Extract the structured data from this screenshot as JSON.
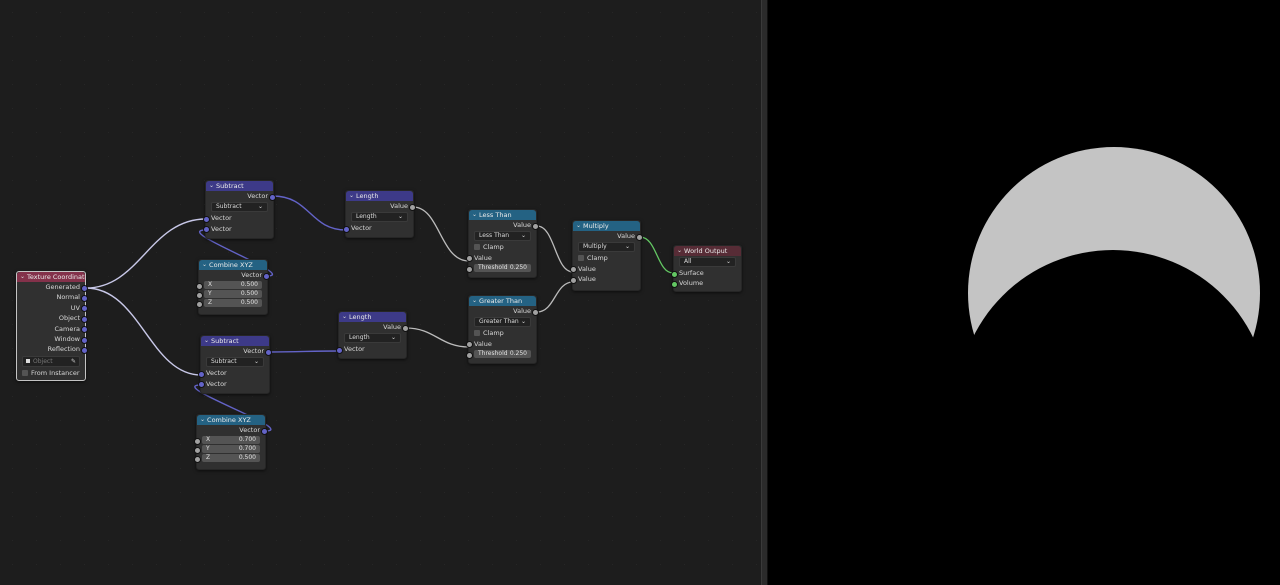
{
  "nodes": {
    "texcoord": {
      "title": "Texture Coordinate",
      "outputs": [
        "Generated",
        "Normal",
        "UV",
        "Object",
        "Camera",
        "Window",
        "Reflection"
      ],
      "object_placeholder": "Object",
      "from_instancer": "From Instancer"
    },
    "subtract1": {
      "title": "Subtract",
      "out": "Vector",
      "op": "Subtract",
      "in1": "Vector",
      "in2": "Vector"
    },
    "combine1": {
      "title": "Combine XYZ",
      "out": "Vector",
      "x_label": "X",
      "x_value": "0.500",
      "y_label": "Y",
      "y_value": "0.500",
      "z_label": "Z",
      "z_value": "0.500"
    },
    "length1": {
      "title": "Length",
      "out": "Value",
      "op": "Length",
      "in1": "Vector"
    },
    "lessthan": {
      "title": "Less Than",
      "out": "Value",
      "op": "Less Than",
      "clamp": "Clamp",
      "in1": "Value",
      "threshold_label": "Threshold",
      "threshold_value": "0.250"
    },
    "multiply": {
      "title": "Multiply",
      "out": "Value",
      "op": "Multiply",
      "clamp": "Clamp",
      "in1": "Value",
      "in2": "Value"
    },
    "worldout": {
      "title": "World Output",
      "target": "All",
      "in1": "Surface",
      "in2": "Volume"
    },
    "subtract2": {
      "title": "Subtract",
      "out": "Vector",
      "op": "Subtract",
      "in1": "Vector",
      "in2": "Vector"
    },
    "combine2": {
      "title": "Combine XYZ",
      "out": "Vector",
      "x_label": "X",
      "x_value": "0.700",
      "y_label": "Y",
      "y_value": "0.700",
      "z_label": "Z",
      "z_value": "0.500"
    },
    "length2": {
      "title": "Length",
      "out": "Value",
      "op": "Length",
      "in1": "Vector"
    },
    "greaterthan": {
      "title": "Greater Than",
      "out": "Value",
      "op": "Greater Than",
      "clamp": "Clamp",
      "in1": "Value",
      "threshold_label": "Threshold",
      "threshold_value": "0.250"
    }
  },
  "colors": {
    "vector_header": "#3d3a88",
    "converter_header": "#246283",
    "input_header": "#83314a",
    "output_header": "#572c36",
    "vector_socket": "#6363c7",
    "value_socket": "#a1a1a1",
    "shader_socket": "#63c763",
    "crescent": "#c4c4c4"
  }
}
